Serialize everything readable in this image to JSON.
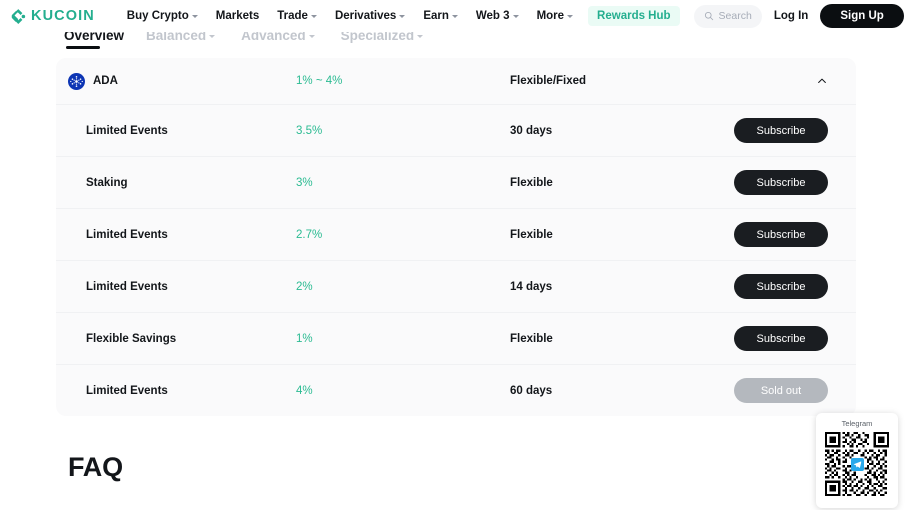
{
  "header": {
    "brand": "KUCOIN",
    "nav_items": [
      {
        "label": "Buy Crypto",
        "has_caret": true
      },
      {
        "label": "Markets",
        "has_caret": false
      },
      {
        "label": "Trade",
        "has_caret": true
      },
      {
        "label": "Derivatives",
        "has_caret": true
      },
      {
        "label": "Earn",
        "has_caret": true
      },
      {
        "label": "Web 3",
        "has_caret": true
      },
      {
        "label": "More",
        "has_caret": true
      }
    ],
    "rewards_hub": "Rewards Hub",
    "search_placeholder": "Search",
    "login": "Log In",
    "signup": "Sign Up",
    "colors": {
      "brand_green": "#24AE8F",
      "signup_bg": "#0B0E11",
      "rewards_bg": "#EAFBF5"
    }
  },
  "subtabs": [
    {
      "label": "Overview",
      "active": true,
      "has_caret": false
    },
    {
      "label": "Balanced",
      "active": false,
      "has_caret": true
    },
    {
      "label": "Advanced",
      "active": false,
      "has_caret": true
    },
    {
      "label": "Specialized",
      "active": false,
      "has_caret": true
    }
  ],
  "coin_group": {
    "symbol": "ADA",
    "apr_range": "1% ~ 4%",
    "term": "Flexible/Fixed",
    "expanded": true,
    "icon": "cardano-icon",
    "apr_color": "#2BBB92"
  },
  "products": [
    {
      "type": "Limited Events",
      "apr": "3.5%",
      "term": "30 days",
      "action": "Subscribe",
      "sold_out": false
    },
    {
      "type": "Staking",
      "apr": "3%",
      "term": "Flexible",
      "action": "Subscribe",
      "sold_out": false
    },
    {
      "type": "Limited Events",
      "apr": "2.7%",
      "term": "Flexible",
      "action": "Subscribe",
      "sold_out": false
    },
    {
      "type": "Limited Events",
      "apr": "2%",
      "term": "14 days",
      "action": "Subscribe",
      "sold_out": false
    },
    {
      "type": "Flexible Savings",
      "apr": "1%",
      "term": "Flexible",
      "action": "Subscribe",
      "sold_out": false
    },
    {
      "type": "Limited Events",
      "apr": "4%",
      "term": "60 days",
      "action": "Sold out",
      "sold_out": true
    }
  ],
  "faq": {
    "title": "FAQ"
  },
  "telegram_widget": {
    "label": "Telegram"
  }
}
